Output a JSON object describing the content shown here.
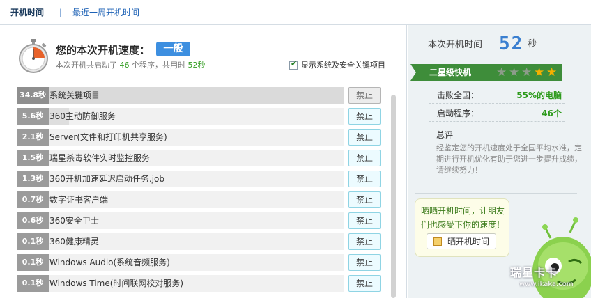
{
  "tabs": {
    "active": "开机时间",
    "separator": "|",
    "other": "最近一周开机时间"
  },
  "header": {
    "speed_title": "您的本次开机速度：",
    "speed_rating": "一般",
    "summary_prefix": "本次开机共启动了",
    "program_count": "46",
    "summary_middle": "个程序，共用时",
    "total_time": "52秒",
    "show_system_items_label": "显示系统及安全关键项目",
    "show_system_items_checked": true
  },
  "items": [
    {
      "time": "34.8秒",
      "name": "系统关键项目",
      "action": "禁止",
      "enabled": false,
      "fill": 1.0
    },
    {
      "time": "5.6秒",
      "name": "360主动防御服务",
      "action": "禁止",
      "enabled": true,
      "fill": 0.16
    },
    {
      "time": "2.1秒",
      "name": "Server(文件和打印机共享服务)",
      "action": "禁止",
      "enabled": true,
      "fill": 0.06
    },
    {
      "time": "1.5秒",
      "name": "瑞星杀毒软件实时监控服务",
      "action": "禁止",
      "enabled": true,
      "fill": 0.04
    },
    {
      "time": "1.3秒",
      "name": "360开机加速延迟启动任务.job",
      "action": "禁止",
      "enabled": true,
      "fill": 0.04
    },
    {
      "time": "0.7秒",
      "name": "数字证书客户端",
      "action": "禁止",
      "enabled": true,
      "fill": 0.02
    },
    {
      "time": "0.6秒",
      "name": "360安全卫士",
      "action": "禁止",
      "enabled": true,
      "fill": 0.02
    },
    {
      "time": "0.1秒",
      "name": "360健康精灵",
      "action": "禁止",
      "enabled": true,
      "fill": 0.0
    },
    {
      "time": "0.1秒",
      "name": "Windows Audio(系统音频服务)",
      "action": "禁止",
      "enabled": true,
      "fill": 0.0
    },
    {
      "time": "0.1秒",
      "name": "Windows Time(时间联网校对服务)",
      "action": "禁止",
      "enabled": true,
      "fill": 0.0
    }
  ],
  "side": {
    "boot_time_label": "本次开机时间",
    "boot_time_value": "52",
    "boot_time_unit": "秒",
    "rank_label": "二星级快机",
    "stars_total": 5,
    "stars_lit": 2,
    "beat_label": "击败全国：",
    "beat_value": "55%的电脑",
    "startup_label": "启动程序：",
    "startup_value": "46个",
    "review_title": "总评",
    "review_text": "经鉴定您的开机速度处于全国平均水准，定期进行开机优化有助于您进一步提升成绩，请继续努力！",
    "share_prompt": "晒晒开机时间，让朋友们也感受下你的速度！",
    "share_button": "晒开机时间",
    "watermark_brand": "瑞星卡卡",
    "watermark_url": "www.ikaka.com"
  },
  "colors": {
    "accent_blue": "#3d8fe0",
    "value_green": "#2e9b1d",
    "rank_green": "#3e8d3a",
    "star_gold": "#f5b000"
  }
}
